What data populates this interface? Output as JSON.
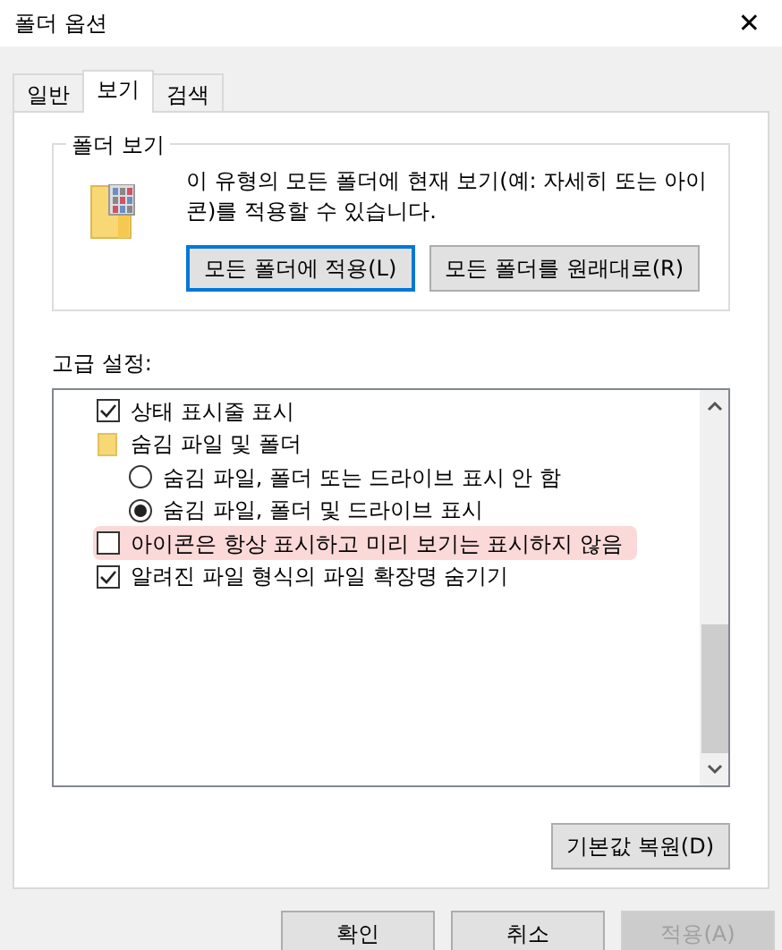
{
  "window": {
    "title": "폴더 옵션",
    "close": "✕"
  },
  "tabs": [
    {
      "label": "일반",
      "selected": false
    },
    {
      "label": "보기",
      "selected": true
    },
    {
      "label": "검색",
      "selected": false
    }
  ],
  "folder_views": {
    "title": "폴더 보기",
    "description": "이 유형의 모든 폴더에 현재 보기(예: 자세히 또는 아이콘)를 적용할 수 있습니다.",
    "buttons": [
      {
        "label": "모든 폴더에 적용(L)",
        "focused": true
      },
      {
        "label": "모든 폴더를 원래대로(R)",
        "focused": false
      }
    ]
  },
  "advanced": {
    "label": "고급 설정:",
    "items": [
      {
        "kind": "checkbox",
        "label": "상태 표시줄 표시",
        "checked": true,
        "highlighted": false
      },
      {
        "kind": "folder",
        "label": "숨김 파일 및 폴더",
        "highlighted": false,
        "children": [
          {
            "kind": "radio",
            "label": "숨김 파일, 폴더 또는 드라이브 표시 안 함",
            "selected": false,
            "highlighted": false
          },
          {
            "kind": "radio",
            "label": "숨김 파일, 폴더 및 드라이브 표시",
            "selected": true,
            "highlighted": false
          }
        ]
      },
      {
        "kind": "checkbox",
        "label": "아이콘은 항상 표시하고 미리 보기는 표시하지 않음",
        "checked": false,
        "highlighted": true
      },
      {
        "kind": "checkbox",
        "label": "알려진 파일 형식의 파일 확장명 숨기기",
        "checked": true,
        "highlighted": false
      }
    ]
  },
  "restore_button": "기본값 복원(D)",
  "footer_buttons": [
    {
      "label": "확인",
      "disabled": false
    },
    {
      "label": "취소",
      "disabled": false
    },
    {
      "label": "적용(A)",
      "disabled": true
    }
  ]
}
